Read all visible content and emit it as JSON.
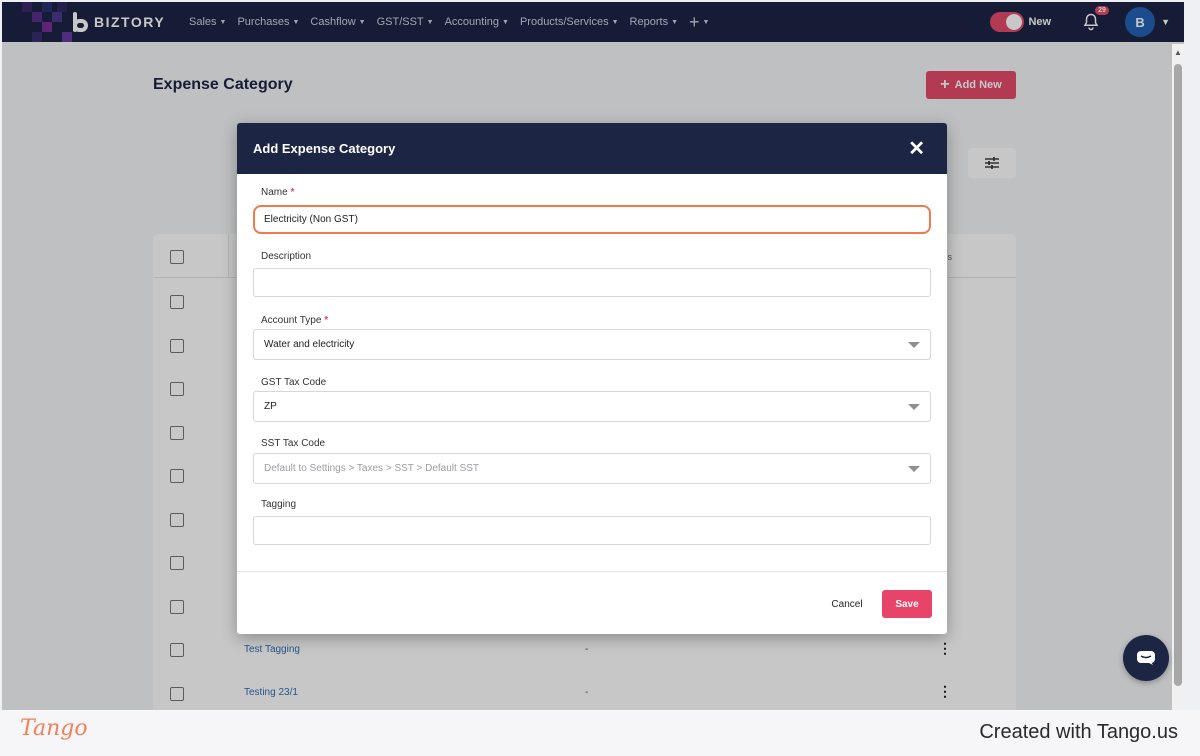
{
  "app": {
    "brand": "BIZTORY"
  },
  "nav": {
    "menu": [
      "Sales",
      "Purchases",
      "Cashflow",
      "GST/SST",
      "Accounting",
      "Products/Services",
      "Reports"
    ],
    "toggle_label": "New",
    "notification_count": "29",
    "avatar_initial": "B"
  },
  "page": {
    "title": "Expense Category",
    "add_new_label": "Add New",
    "header_partial": "s",
    "rows": [
      {
        "name": "Test Tagging",
        "description": "-"
      },
      {
        "name": "Testing 23/1",
        "description": "-"
      }
    ]
  },
  "modal": {
    "title": "Add Expense Category",
    "name_label": "Name",
    "name_value": "Electricity (Non GST)",
    "description_label": "Description",
    "description_value": "",
    "account_type_label": "Account Type",
    "account_type_value": "Water and electricity",
    "gst_label": "GST Tax Code",
    "gst_value": "ZP",
    "sst_label": "SST Tax Code",
    "sst_placeholder": "Default to Settings > Taxes > SST > Default SST",
    "tagging_label": "Tagging",
    "tagging_value": "",
    "required_mark": "*",
    "cancel_label": "Cancel",
    "save_label": "Save"
  },
  "footer": {
    "logo": "Tango",
    "credit": "Created with Tango.us"
  },
  "colors": {
    "nav_bg": "#1d2545",
    "accent": "#e44b6a",
    "focus_outline": "#f07a4a",
    "link": "#2f6fb6"
  }
}
